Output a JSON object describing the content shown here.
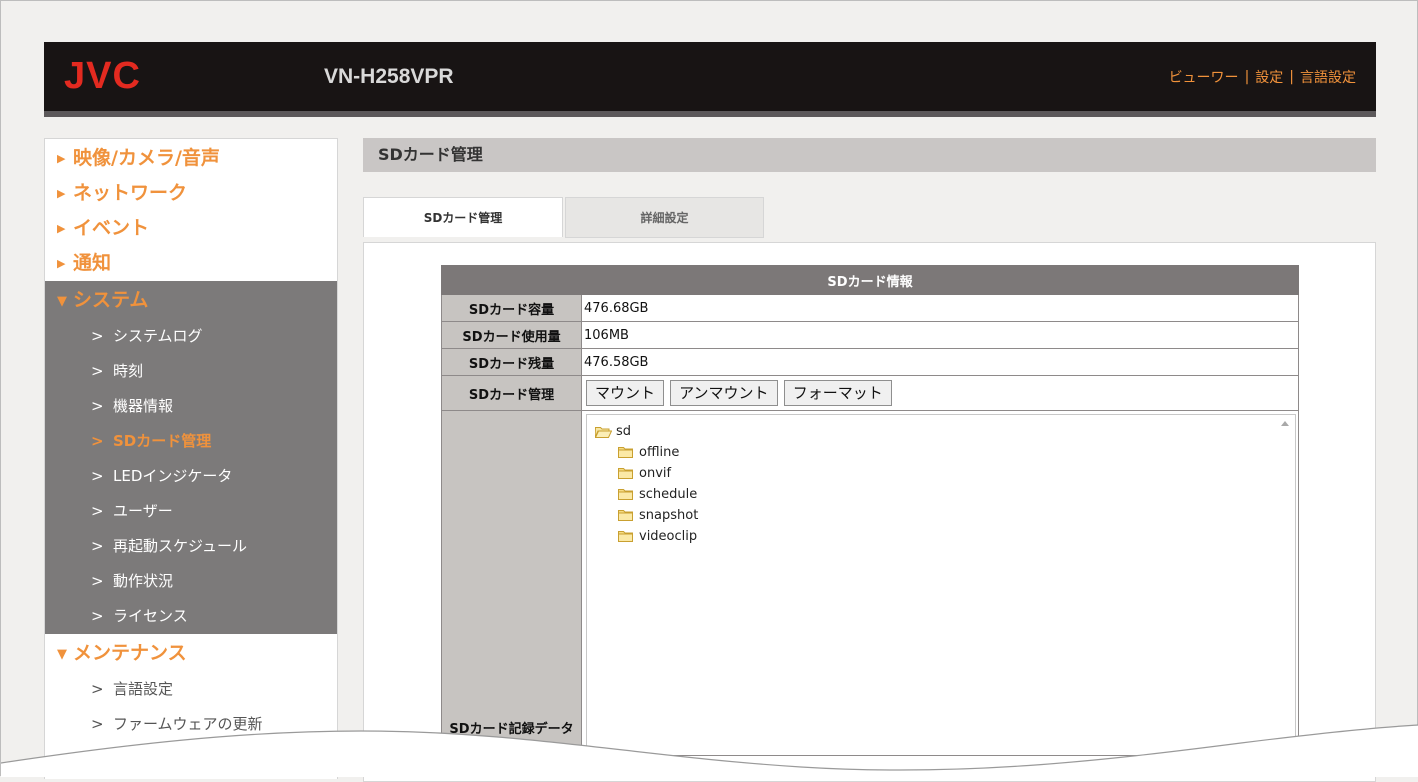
{
  "header": {
    "logo_text": "JVC",
    "model": "VN-H258VPR",
    "nav": [
      "ビューワー",
      "設定",
      "言語設定"
    ],
    "brand_color": "#e32a20",
    "accent_color": "#f0923c"
  },
  "sidebar": {
    "categories": [
      {
        "label": "映像/カメラ/音声",
        "expanded": false
      },
      {
        "label": "ネットワーク",
        "expanded": false
      },
      {
        "label": "イベント",
        "expanded": false
      },
      {
        "label": "通知",
        "expanded": false
      },
      {
        "label": "システム",
        "expanded": true,
        "items": [
          "システムログ",
          "時刻",
          "機器情報",
          "SDカード管理",
          "LEDインジケータ",
          "ユーザー",
          "再起動スケジュール",
          "動作状況",
          "ライセンス"
        ],
        "active_item": "SDカード管理"
      },
      {
        "label": "メンテナンス",
        "expanded": true,
        "items": [
          "言語設定",
          "ファームウェアの更新"
        ]
      }
    ],
    "marker": ">"
  },
  "page": {
    "title": "SDカード管理",
    "tabs": [
      {
        "label": "SDカード管理",
        "active": true
      },
      {
        "label": "詳細設定",
        "active": false
      }
    ]
  },
  "sd_info": {
    "heading": "SDカード情報",
    "rows": [
      {
        "label": "SDカード容量",
        "value": "476.68GB"
      },
      {
        "label": "SDカード使用量",
        "value": "106MB"
      },
      {
        "label": "SDカード残量",
        "value": "476.58GB"
      }
    ],
    "manage_label": "SDカード管理",
    "buttons": [
      "マウント",
      "アンマウント",
      "フォーマット"
    ],
    "record_label": "SDカード記録データ",
    "tree": {
      "root": "sd",
      "children": [
        "offline",
        "onvif",
        "schedule",
        "snapshot",
        "videoclip"
      ]
    }
  }
}
